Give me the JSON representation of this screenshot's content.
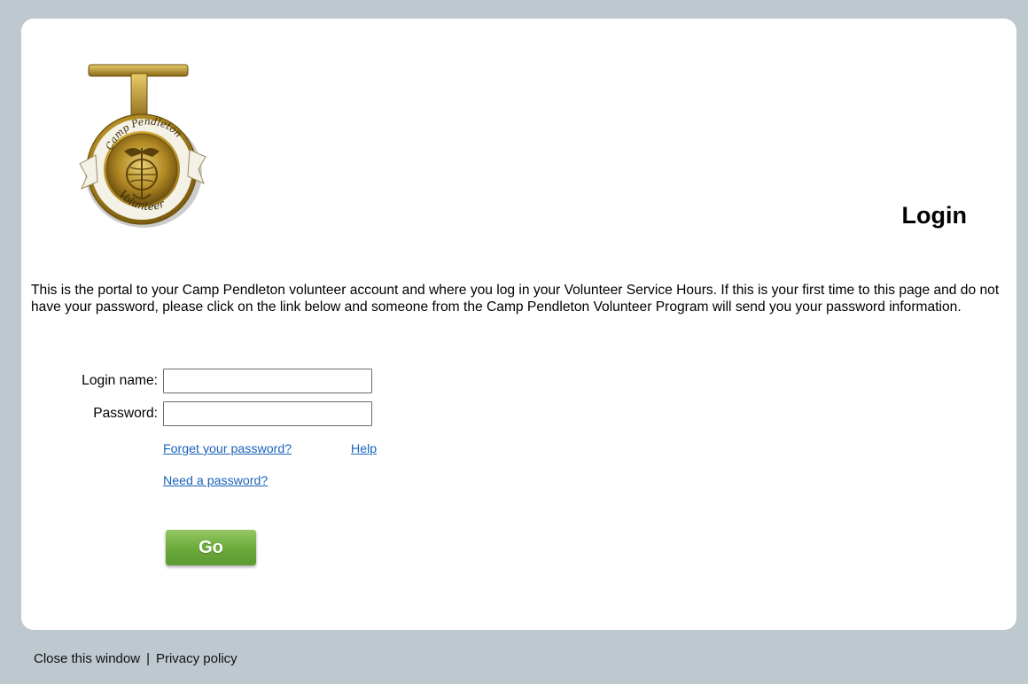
{
  "header": {
    "title": "Login",
    "logo": {
      "top_text": "Camp Pendleton",
      "bottom_text": "Volunteer"
    }
  },
  "intro": {
    "text": "This is the portal to your Camp Pendleton volunteer account and where you log in your Volunteer Service Hours. If this is your first time to this page and do not have your password, please click on the link below and someone from the Camp Pendleton Volunteer Program will send you your password information."
  },
  "form": {
    "login_label": "Login name:",
    "login_value": "",
    "password_label": "Password:",
    "password_value": "",
    "forgot_link": "Forget your password?",
    "help_link": "Help",
    "need_link": "Need a password?",
    "go_label": "Go"
  },
  "footer": {
    "close_link": "Close this window",
    "separator": "|",
    "privacy_link": "Privacy policy"
  },
  "colors": {
    "background": "#bec8cf",
    "card": "#ffffff",
    "link": "#1a63b8",
    "button": "#6aa93a",
    "gold": "#c9a12c"
  }
}
